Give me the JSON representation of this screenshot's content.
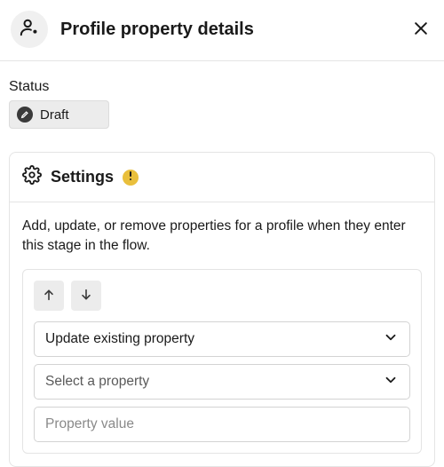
{
  "header": {
    "title": "Profile property details"
  },
  "status": {
    "label": "Status",
    "value": "Draft"
  },
  "settings": {
    "title": "Settings",
    "description": "Add, update, or remove properties for a profile when they enter this stage in the flow.",
    "action_select": "Update existing property",
    "property_select": "Select a property",
    "value_placeholder": "Property value"
  }
}
